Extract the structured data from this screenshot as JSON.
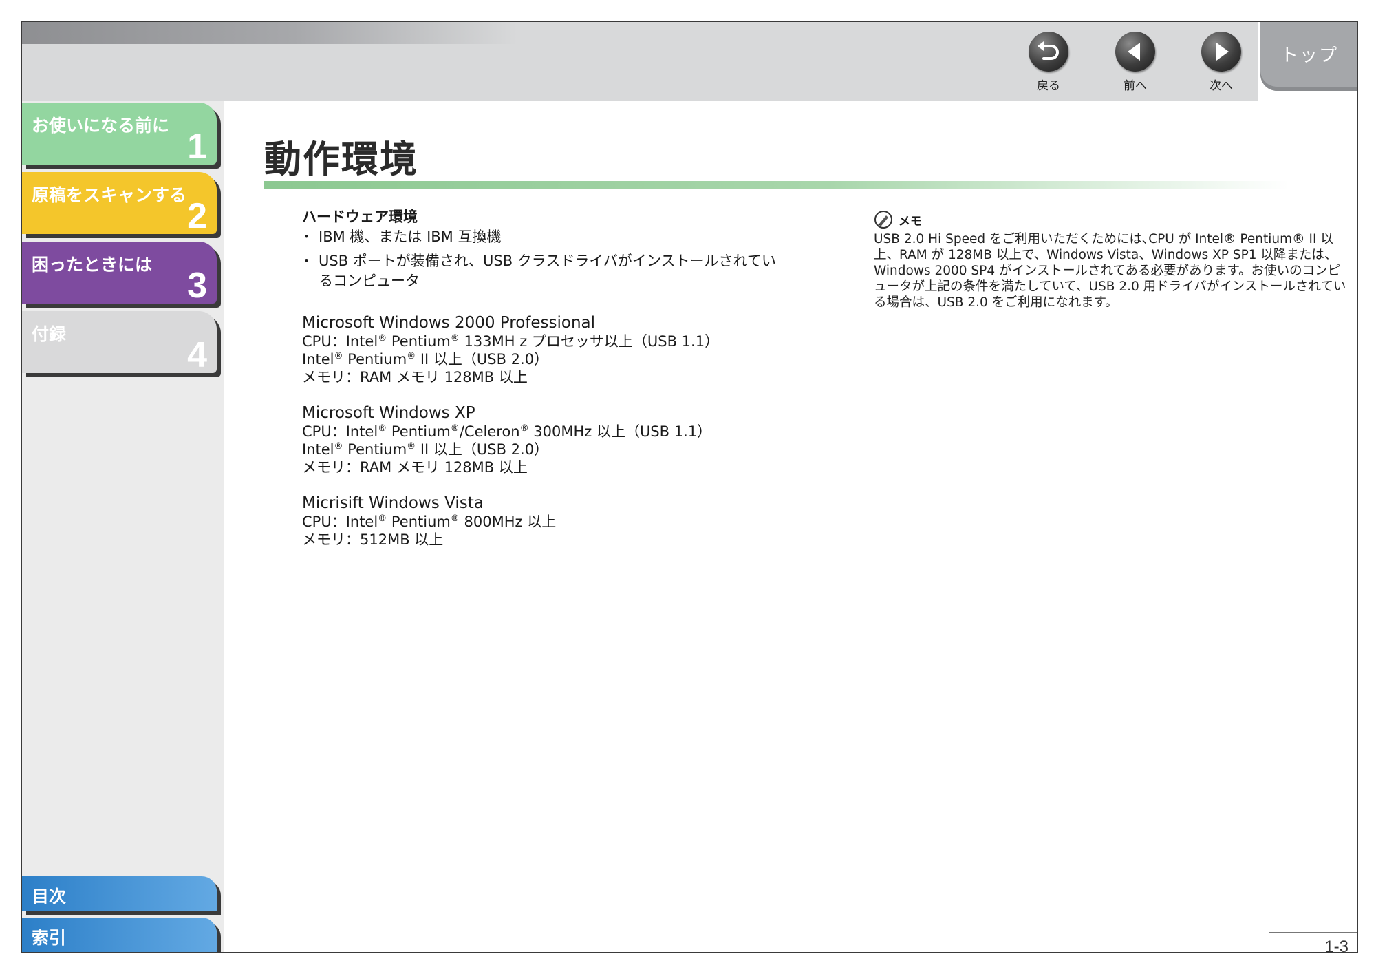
{
  "nav": {
    "back_label": "戻る",
    "prev_label": "前へ",
    "next_label": "次へ",
    "top_label": "トップ"
  },
  "sidebar": {
    "tabs": [
      {
        "label": "お使いになる前に",
        "number": "1",
        "color": "#93d6a0"
      },
      {
        "label": "原稿をスキャンする",
        "number": "2",
        "color": "#f4c62b"
      },
      {
        "label": "困ったときには",
        "number": "3",
        "color": "#7e4b9f"
      },
      {
        "label": "付録",
        "number": "4",
        "color": "#d9d9da"
      }
    ],
    "toc_label": "目次",
    "index_label": "索引"
  },
  "page": {
    "title": "動作環境",
    "hardware_heading": "ハードウェア環境",
    "bullets": [
      "IBM 機、または IBM 互換機",
      "USB ポートが装備され、USB クラスドライバがインストールされているコンピュータ"
    ],
    "os_specs": [
      {
        "name": "Microsoft Windows 2000 Professional",
        "lines": [
          [
            "CPU：Intel",
            "®",
            " Pentium",
            "®",
            " 133MH z プロセッサ以上（USB 1.1）"
          ],
          [
            "Intel",
            "®",
            " Pentium",
            "®",
            " II 以上（USB 2.0）"
          ],
          [
            "メモリ：RAM メモリ 128MB 以上"
          ]
        ]
      },
      {
        "name": "Microsoft Windows XP",
        "lines": [
          [
            "CPU：Intel",
            "®",
            " Pentium",
            "®",
            "/Celeron",
            "®",
            " 300MHz 以上（USB 1.1）"
          ],
          [
            "Intel",
            "®",
            " Pentium",
            "®",
            " II 以上（USB 2.0）"
          ],
          [
            "メモリ：RAM メモリ 128MB 以上"
          ]
        ]
      },
      {
        "name": "Micrisift Windows Vista",
        "lines": [
          [
            "CPU：Intel",
            "®",
            " Pentium",
            "®",
            " 800MHz 以上"
          ],
          [
            "メモリ：512MB 以上"
          ]
        ]
      }
    ],
    "memo_heading": "メモ",
    "memo_text": "USB 2.0 Hi Speed をご利用いただくためには､CPU が Intel® Pentium® II 以上、RAM が 128MB 以上で、Windows Vista、Windows XP SP1 以降または、Windows 2000 SP4 がインストールされてある必要があります。お使いのコンピュータが上記の条件を満たしていて、USB 2.0 用ドライバがインストールされている場合は、USB 2.0 をご利用になれます。",
    "page_number": "1-3"
  },
  "icons": {
    "back": "back-arrow-icon",
    "prev": "left-triangle-icon",
    "next": "right-triangle-icon",
    "memo": "pencil-icon"
  }
}
